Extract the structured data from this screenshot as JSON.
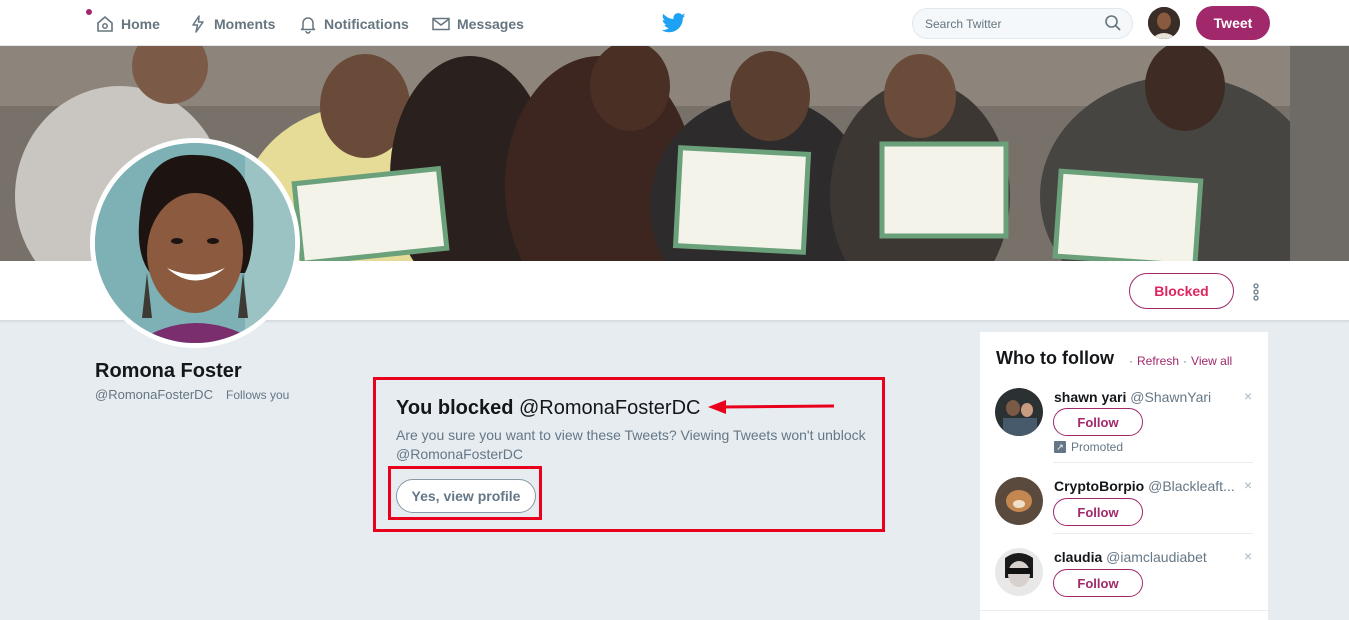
{
  "nav": {
    "home": "Home",
    "moments": "Moments",
    "notifications": "Notifications",
    "messages": "Messages",
    "search_placeholder": "Search Twitter",
    "tweet_button": "Tweet"
  },
  "profile": {
    "name": "Romona Foster",
    "handle": "@RomonaFosterDC",
    "follows_you": "Follows you",
    "blocked_button": "Blocked"
  },
  "blocked_notice": {
    "title_bold": "You blocked",
    "title_handle": "@RomonaFosterDC",
    "description": "Are you sure you want to view these Tweets? Viewing Tweets won't unblock @RomonaFosterDC",
    "view_button": "Yes, view profile"
  },
  "who_to_follow": {
    "title": "Who to follow",
    "refresh": "Refresh",
    "separator": "·",
    "view_all": "View all",
    "users": [
      {
        "name": "shawn yari",
        "handle": "@ShawnYari",
        "follow": "Follow",
        "promoted": "Promoted"
      },
      {
        "name": "CryptoBorpio",
        "handle": "@Blackleaft...",
        "follow": "Follow"
      },
      {
        "name": "claudia",
        "handle": "@iamclaudiabet",
        "follow": "Follow"
      }
    ],
    "close_glyph": "×"
  },
  "colors": {
    "accent": "#a0286b",
    "blocked_text": "#e0245e",
    "annotation_red": "#e8001c",
    "twitter_blue": "#1da1f2"
  }
}
